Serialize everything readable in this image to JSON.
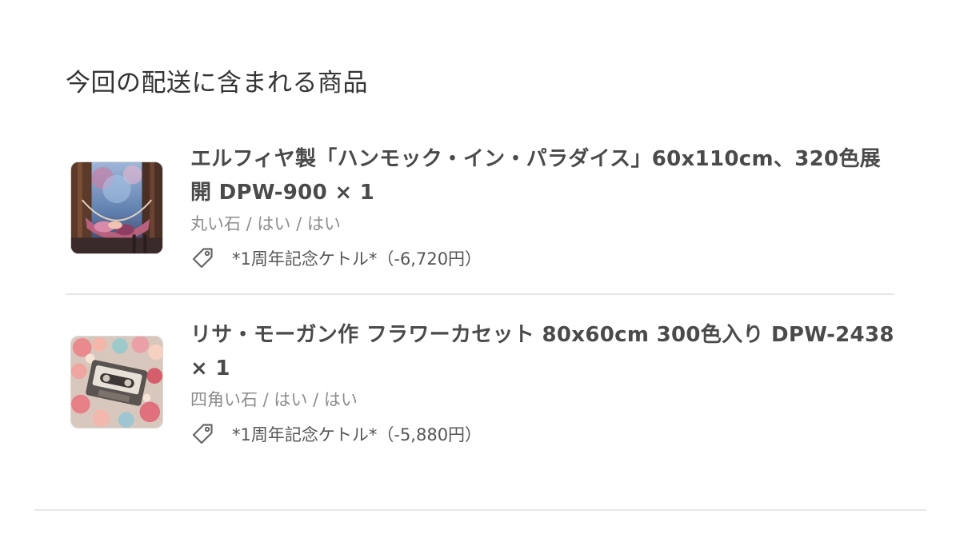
{
  "section": {
    "title": "今回の配送に含まれる商品"
  },
  "items": [
    {
      "title": "エルフィヤ製「ハンモック・イン・パラダイス」60x110cm、320色展開 DPW-900 × 1",
      "variant": "丸い石 / はい / はい",
      "discount": "*1周年記念ケトル*（-6,720円）",
      "thumbnail_icon": "hammock-painting-thumbnail",
      "discount_icon": "tag-icon"
    },
    {
      "title": "リサ・モーガン作 フラワーカセット 80x60cm 300色入り DPW-2438 × 1",
      "variant": "四角い石 / はい / はい",
      "discount": "*1周年記念ケトル*（-5,880円）",
      "thumbnail_icon": "flower-cassette-thumbnail",
      "discount_icon": "tag-icon"
    }
  ],
  "colors": {
    "text_primary": "#333333",
    "text_secondary": "#8c8c8c",
    "divider": "#e6e6e6"
  }
}
